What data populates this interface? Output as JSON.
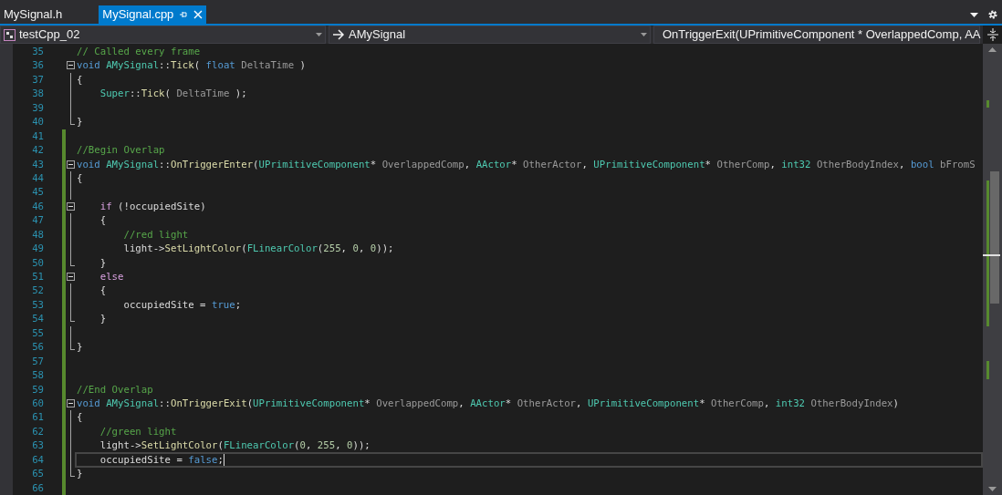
{
  "tabs": [
    {
      "label": "MySignal.h",
      "selected": false
    },
    {
      "label": "MySignal.cpp",
      "selected": true
    }
  ],
  "navigation": {
    "project": "testCpp_02",
    "scope": "AMySignal",
    "member": "OnTriggerExit(UPrimitiveComponent * OverlappedComp, AA"
  },
  "code_lines": [
    {
      "number": "35",
      "changed": false,
      "fold": false,
      "in_block": false,
      "block_end": false,
      "current": false,
      "tokens": [
        {
          "kind": "comment",
          "text": "// Called every frame"
        }
      ]
    },
    {
      "number": "36",
      "changed": false,
      "fold": true,
      "in_block": false,
      "block_end": false,
      "current": false,
      "tokens": [
        {
          "kind": "keyword",
          "text": "void"
        },
        {
          "kind": "type",
          "text": " AMySignal"
        },
        {
          "kind": "plain",
          "text": "::"
        },
        {
          "kind": "function",
          "text": "Tick"
        },
        {
          "kind": "plain",
          "text": "( "
        },
        {
          "kind": "keyword",
          "text": "float"
        },
        {
          "kind": "param",
          "text": " DeltaTime"
        },
        {
          "kind": "plain",
          "text": " )"
        }
      ]
    },
    {
      "number": "37",
      "changed": false,
      "fold": false,
      "in_block": true,
      "block_end": false,
      "current": false,
      "tokens": [
        {
          "kind": "plain",
          "text": "{"
        }
      ]
    },
    {
      "number": "38",
      "changed": false,
      "fold": false,
      "in_block": true,
      "block_end": false,
      "current": false,
      "tokens": [
        {
          "kind": "type",
          "text": "    Super"
        },
        {
          "kind": "plain",
          "text": "::"
        },
        {
          "kind": "function",
          "text": "Tick"
        },
        {
          "kind": "plain",
          "text": "( "
        },
        {
          "kind": "param",
          "text": "DeltaTime"
        },
        {
          "kind": "plain",
          "text": " );"
        }
      ]
    },
    {
      "number": "39",
      "changed": false,
      "fold": false,
      "in_block": true,
      "block_end": false,
      "current": false
    },
    {
      "number": "40",
      "changed": false,
      "fold": false,
      "in_block": false,
      "block_end": true,
      "current": false,
      "tokens": [
        {
          "kind": "plain",
          "text": "}"
        }
      ]
    },
    {
      "number": "41",
      "changed": true,
      "fold": false,
      "in_block": false,
      "block_end": false,
      "current": false
    },
    {
      "number": "42",
      "changed": true,
      "fold": false,
      "in_block": false,
      "block_end": false,
      "current": false,
      "tokens": [
        {
          "kind": "comment",
          "text": "//Begin Overlap"
        }
      ]
    },
    {
      "number": "43",
      "changed": true,
      "fold": true,
      "in_block": false,
      "block_end": false,
      "current": false,
      "tokens": [
        {
          "kind": "keyword",
          "text": "void"
        },
        {
          "kind": "type",
          "text": " AMySignal"
        },
        {
          "kind": "plain",
          "text": "::"
        },
        {
          "kind": "function",
          "text": "OnTriggerEnter"
        },
        {
          "kind": "plain",
          "text": "("
        },
        {
          "kind": "type",
          "text": "UPrimitiveComponent"
        },
        {
          "kind": "plain",
          "text": "* "
        },
        {
          "kind": "param",
          "text": "OverlappedComp"
        },
        {
          "kind": "plain",
          "text": ", "
        },
        {
          "kind": "type",
          "text": "AActor"
        },
        {
          "kind": "plain",
          "text": "* "
        },
        {
          "kind": "param",
          "text": "OtherActor"
        },
        {
          "kind": "plain",
          "text": ", "
        },
        {
          "kind": "type",
          "text": "UPrimitiveComponent"
        },
        {
          "kind": "plain",
          "text": "* "
        },
        {
          "kind": "param",
          "text": "OtherComp"
        },
        {
          "kind": "plain",
          "text": ", "
        },
        {
          "kind": "type",
          "text": "int32"
        },
        {
          "kind": "param",
          "text": " OtherBodyIndex"
        },
        {
          "kind": "plain",
          "text": ", "
        },
        {
          "kind": "keyword",
          "text": "bool"
        },
        {
          "kind": "param",
          "text": " bFromS"
        }
      ]
    },
    {
      "number": "44",
      "changed": true,
      "fold": false,
      "in_block": true,
      "block_end": false,
      "current": false,
      "tokens": [
        {
          "kind": "plain",
          "text": "{"
        }
      ]
    },
    {
      "number": "45",
      "changed": true,
      "fold": false,
      "in_block": true,
      "block_end": false,
      "current": false
    },
    {
      "number": "46",
      "changed": true,
      "fold": true,
      "in_block": false,
      "block_end": false,
      "current": false,
      "tokens": [
        {
          "kind": "control",
          "text": "    if"
        },
        {
          "kind": "plain",
          "text": " (!occupiedSite)"
        }
      ]
    },
    {
      "number": "47",
      "changed": true,
      "fold": false,
      "in_block": true,
      "block_end": false,
      "current": false,
      "tokens": [
        {
          "kind": "plain",
          "text": "    {"
        }
      ]
    },
    {
      "number": "48",
      "changed": true,
      "fold": false,
      "in_block": true,
      "block_end": false,
      "current": false,
      "tokens": [
        {
          "kind": "comment",
          "text": "        //red light"
        }
      ]
    },
    {
      "number": "49",
      "changed": true,
      "fold": false,
      "in_block": true,
      "block_end": false,
      "current": false,
      "tokens": [
        {
          "kind": "plain",
          "text": "        light->"
        },
        {
          "kind": "function",
          "text": "SetLightColor"
        },
        {
          "kind": "plain",
          "text": "("
        },
        {
          "kind": "type",
          "text": "FLinearColor"
        },
        {
          "kind": "plain",
          "text": "("
        },
        {
          "kind": "number",
          "text": "255"
        },
        {
          "kind": "plain",
          "text": ", "
        },
        {
          "kind": "number",
          "text": "0"
        },
        {
          "kind": "plain",
          "text": ", "
        },
        {
          "kind": "number",
          "text": "0"
        },
        {
          "kind": "plain",
          "text": "));"
        }
      ]
    },
    {
      "number": "50",
      "changed": true,
      "fold": false,
      "in_block": false,
      "block_end": true,
      "current": false,
      "tokens": [
        {
          "kind": "plain",
          "text": "    }"
        }
      ]
    },
    {
      "number": "51",
      "changed": true,
      "fold": true,
      "in_block": false,
      "block_end": false,
      "current": false,
      "tokens": [
        {
          "kind": "control",
          "text": "    else"
        }
      ]
    },
    {
      "number": "52",
      "changed": true,
      "fold": false,
      "in_block": true,
      "block_end": false,
      "current": false,
      "tokens": [
        {
          "kind": "plain",
          "text": "    {"
        }
      ]
    },
    {
      "number": "53",
      "changed": true,
      "fold": false,
      "in_block": true,
      "block_end": false,
      "current": false,
      "tokens": [
        {
          "kind": "plain",
          "text": "        occupiedSite = "
        },
        {
          "kind": "keyword",
          "text": "true"
        },
        {
          "kind": "plain",
          "text": ";"
        }
      ]
    },
    {
      "number": "54",
      "changed": true,
      "fold": false,
      "in_block": false,
      "block_end": true,
      "current": false,
      "tokens": [
        {
          "kind": "plain",
          "text": "    }"
        }
      ]
    },
    {
      "number": "55",
      "changed": true,
      "fold": false,
      "in_block": true,
      "block_end": false,
      "current": false
    },
    {
      "number": "56",
      "changed": true,
      "fold": false,
      "in_block": false,
      "block_end": true,
      "current": false,
      "tokens": [
        {
          "kind": "plain",
          "text": "}"
        }
      ]
    },
    {
      "number": "57",
      "changed": true,
      "fold": false,
      "in_block": false,
      "block_end": false,
      "current": false
    },
    {
      "number": "58",
      "changed": true,
      "fold": false,
      "in_block": false,
      "block_end": false,
      "current": false
    },
    {
      "number": "59",
      "changed": true,
      "fold": false,
      "in_block": false,
      "block_end": false,
      "current": false,
      "tokens": [
        {
          "kind": "comment",
          "text": "//End Overlap"
        }
      ]
    },
    {
      "number": "60",
      "changed": true,
      "fold": true,
      "in_block": false,
      "block_end": false,
      "current": false,
      "tokens": [
        {
          "kind": "keyword",
          "text": "void"
        },
        {
          "kind": "type",
          "text": " AMySignal"
        },
        {
          "kind": "plain",
          "text": "::"
        },
        {
          "kind": "function",
          "text": "OnTriggerExit"
        },
        {
          "kind": "plain",
          "text": "("
        },
        {
          "kind": "type",
          "text": "UPrimitiveComponent"
        },
        {
          "kind": "plain",
          "text": "* "
        },
        {
          "kind": "param",
          "text": "OverlappedComp"
        },
        {
          "kind": "plain",
          "text": ", "
        },
        {
          "kind": "type",
          "text": "AActor"
        },
        {
          "kind": "plain",
          "text": "* "
        },
        {
          "kind": "param",
          "text": "OtherActor"
        },
        {
          "kind": "plain",
          "text": ", "
        },
        {
          "kind": "type",
          "text": "UPrimitiveComponent"
        },
        {
          "kind": "plain",
          "text": "* "
        },
        {
          "kind": "param",
          "text": "OtherComp"
        },
        {
          "kind": "plain",
          "text": ", "
        },
        {
          "kind": "type",
          "text": "int32"
        },
        {
          "kind": "param",
          "text": " OtherBodyIndex"
        },
        {
          "kind": "plain",
          "text": ")"
        }
      ]
    },
    {
      "number": "61",
      "changed": true,
      "fold": false,
      "in_block": true,
      "block_end": false,
      "current": false,
      "tokens": [
        {
          "kind": "plain",
          "text": "{"
        }
      ]
    },
    {
      "number": "62",
      "changed": true,
      "fold": false,
      "in_block": true,
      "block_end": false,
      "current": false,
      "tokens": [
        {
          "kind": "comment",
          "text": "    //green light"
        }
      ]
    },
    {
      "number": "63",
      "changed": true,
      "fold": false,
      "in_block": true,
      "block_end": false,
      "current": false,
      "tokens": [
        {
          "kind": "plain",
          "text": "    light->"
        },
        {
          "kind": "function",
          "text": "SetLightColor"
        },
        {
          "kind": "plain",
          "text": "("
        },
        {
          "kind": "type",
          "text": "FLinearColor"
        },
        {
          "kind": "plain",
          "text": "("
        },
        {
          "kind": "number",
          "text": "0"
        },
        {
          "kind": "plain",
          "text": ", "
        },
        {
          "kind": "number",
          "text": "255"
        },
        {
          "kind": "plain",
          "text": ", "
        },
        {
          "kind": "number",
          "text": "0"
        },
        {
          "kind": "plain",
          "text": "));"
        }
      ]
    },
    {
      "number": "64",
      "changed": true,
      "fold": false,
      "in_block": true,
      "block_end": false,
      "current": true,
      "tokens": [
        {
          "kind": "plain",
          "text": "    occupiedSite = "
        },
        {
          "kind": "keyword",
          "text": "false"
        },
        {
          "kind": "plain",
          "text": ";"
        }
      ]
    },
    {
      "number": "65",
      "changed": true,
      "fold": false,
      "in_block": false,
      "block_end": true,
      "current": false,
      "tokens": [
        {
          "kind": "plain",
          "text": "}"
        }
      ]
    },
    {
      "number": "66",
      "changed": true,
      "fold": false,
      "in_block": false,
      "block_end": false,
      "current": false
    }
  ]
}
